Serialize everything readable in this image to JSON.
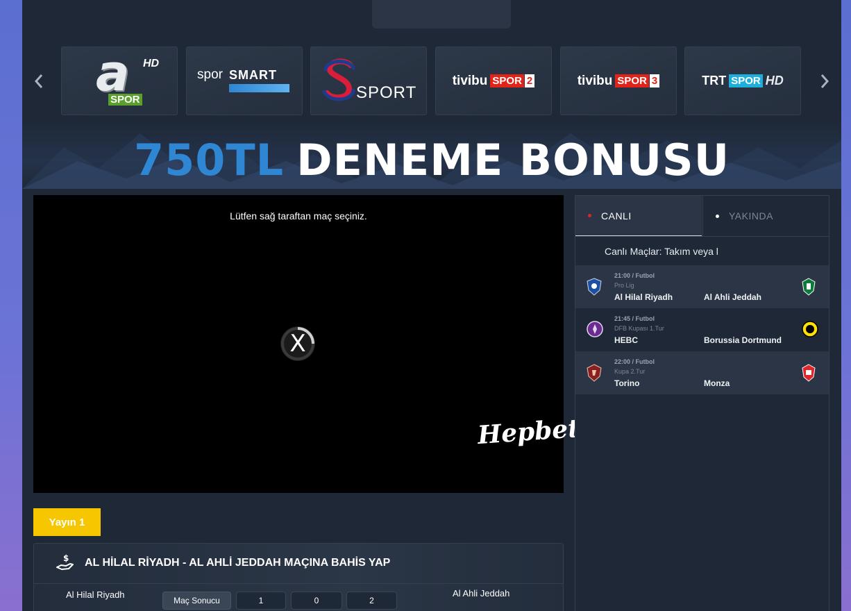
{
  "channels": [
    {
      "name": "A Spor HD"
    },
    {
      "name": "Spor Smart"
    },
    {
      "name": "S Sport"
    },
    {
      "name": "Tivibu Spor 2"
    },
    {
      "name": "Tivibu Spor 3"
    },
    {
      "name": "TRT Spor HD"
    }
  ],
  "channel_logos": {
    "aspor_mark": "a",
    "aspor_hd": "HD",
    "aspor_spor": "SPOR",
    "sporsmart_a": "spor",
    "sporsmart_b": "SMART",
    "ssport_text": "SPORT",
    "tivibu_a": "tivibu",
    "tivibu_spor": "SPOR",
    "tivibu2_num": "2",
    "tivibu3_num": "3",
    "trt_a": "TRT",
    "trt_spor": "SPOR",
    "trt_hd": "HD"
  },
  "banner": {
    "accent": "750TL",
    "main": "DENEME BONUSU"
  },
  "player": {
    "message": "Lütfen sağ taraftan maç seçiniz.",
    "close_label": "X",
    "watermark": "Hepbet"
  },
  "stream_button": "Yayın 1",
  "bet": {
    "title": "AL HİLAL RİYADH - AL AHLİ JEDDAH MAÇINA BAHİS YAP",
    "home": "Al Hilal Riyadh",
    "away": "Al Ahli Jeddah",
    "market": "Maç Sonucu",
    "options": [
      "1",
      "0",
      "2"
    ]
  },
  "tabs": {
    "live": "CANLI",
    "upcoming": "YAKINDA"
  },
  "filter_label": "Canlı Maçlar: Takım veya l",
  "matches": [
    {
      "time": "21:00 / Futbol",
      "league": "Pro Lig",
      "home": "Al Hilal Riyadh",
      "away": "Al Ahli Jeddah"
    },
    {
      "time": "21:45 / Futbol",
      "league": "DFB Kupası 1.Tur",
      "home": "HEBC",
      "away": "Borussia Dortmund"
    },
    {
      "time": "22:00 / Futbol",
      "league": "Kupa 2.Tur",
      "home": "Torino",
      "away": "Monza"
    }
  ],
  "colors": {
    "yellow": "#f6c700",
    "blue_accent": "#2f86d2",
    "panel": "#1e2837",
    "live_dot": "#d4282f"
  }
}
